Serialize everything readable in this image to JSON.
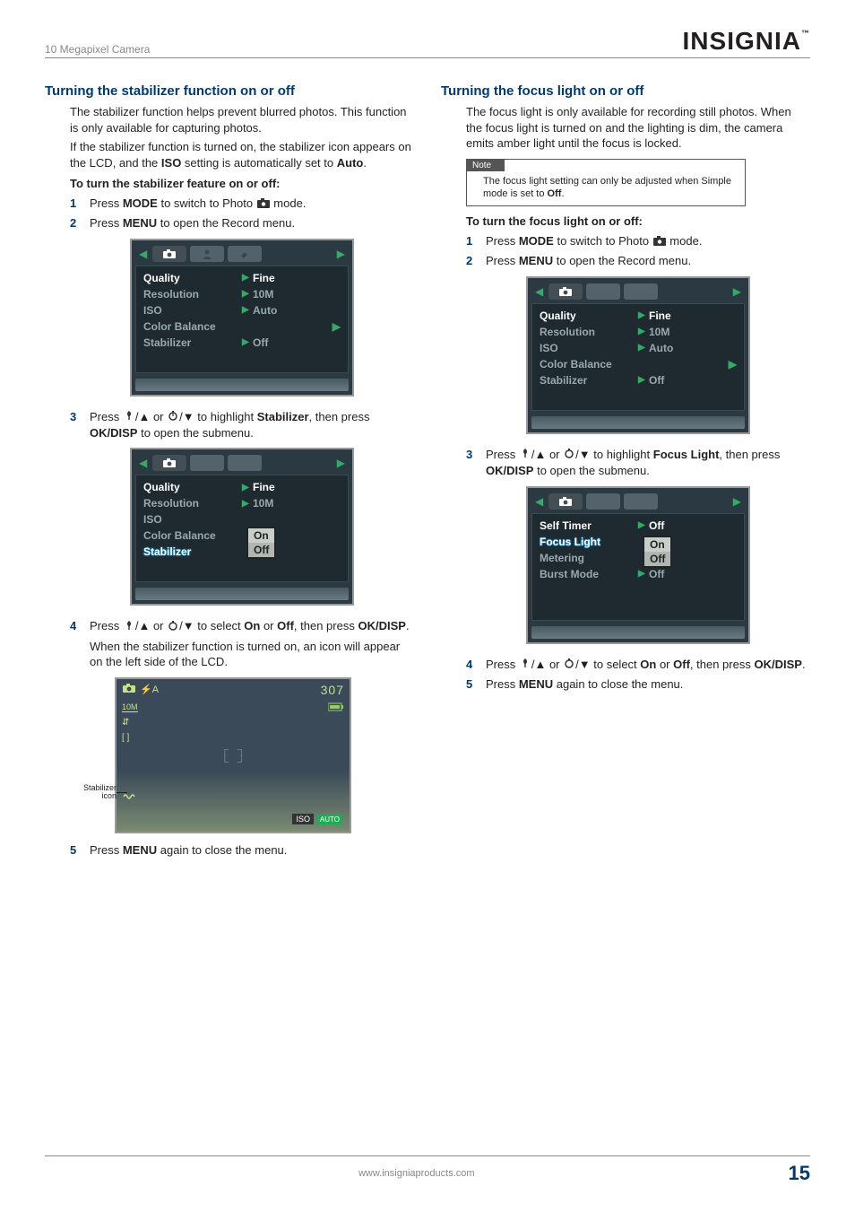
{
  "header": {
    "product": "10 Megapixel Camera",
    "brand": "INSIGNIA",
    "tm": "™"
  },
  "left": {
    "heading": "Turning the stabilizer function on or off",
    "intro1": "The stabilizer function helps prevent blurred photos. This function is only available for capturing photos.",
    "intro2_a": "If the stabilizer function is turned on, the stabilizer icon appears on the LCD, and the ",
    "intro2_iso": "ISO",
    "intro2_b": " setting is automatically set to ",
    "intro2_auto": "Auto",
    "intro2_c": ".",
    "subhead": "To turn the stabilizer feature on or off:",
    "steps": {
      "s1_a": "Press ",
      "s1_mode": "MODE",
      "s1_b": " to switch to Photo ",
      "s1_c": " mode.",
      "s2_a": "Press ",
      "s2_menu": "MENU",
      "s2_b": " to open the Record menu.",
      "s3_a": "Press ",
      "s3_b": " or ",
      "s3_c": " to highlight ",
      "s3_stab": "Stabilizer",
      "s3_d": ", then press ",
      "s3_ok": "OK/DISP",
      "s3_e": " to open the submenu.",
      "s4_a": "Press ",
      "s4_b": " or ",
      "s4_c": " to select ",
      "s4_on": "On",
      "s4_d": " or ",
      "s4_off": "Off",
      "s4_e": ", then press ",
      "s4_ok": "OK/DISP",
      "s4_f": ".",
      "s4_note": "When the stabilizer function is turned on, an icon will appear on the left side of the LCD.",
      "s5_a": "Press ",
      "s5_menu": "MENU",
      "s5_b": " again to close the menu."
    },
    "callout": "Stabilizer icon",
    "preview": {
      "counter": "307",
      "res": "10M",
      "iso": "ISO",
      "auto": "AUTO"
    }
  },
  "right": {
    "heading": "Turning the focus light on or off",
    "intro": "The focus light is only available for recording still photos. When the focus light is turned on and the lighting is dim, the camera emits amber light until the focus is locked.",
    "note_title": "Note",
    "note_a": "The focus light setting can only be adjusted when Simple mode is set to ",
    "note_off": "Off",
    "note_b": ".",
    "subhead": "To turn the focus light on or off:",
    "steps": {
      "s1_a": "Press ",
      "s1_mode": "MODE",
      "s1_b": " to switch to Photo ",
      "s1_c": " mode.",
      "s2_a": "Press ",
      "s2_menu": "MENU",
      "s2_b": " to open the Record menu.",
      "s3_a": "Press ",
      "s3_b": " or ",
      "s3_c": " to highlight ",
      "s3_fl": "Focus Light",
      "s3_d": ", then press ",
      "s3_ok": "OK/DISP",
      "s3_e": " to open the submenu.",
      "s4_a": "Press ",
      "s4_b": " or ",
      "s4_c": " to select ",
      "s4_on": "On",
      "s4_d": " or ",
      "s4_off": "Off",
      "s4_e": ", then press ",
      "s4_ok": "OK/DISP",
      "s4_f": ".",
      "s5_a": "Press ",
      "s5_menu": "MENU",
      "s5_b": " again to close the menu."
    }
  },
  "menus": {
    "record": {
      "rows": [
        {
          "label": "Quality",
          "value": "Fine",
          "sel": true,
          "caret": true
        },
        {
          "label": "Resolution",
          "value": "10M",
          "caret": true
        },
        {
          "label": "ISO",
          "value": "Auto",
          "caret": true
        },
        {
          "label": "Color Balance",
          "value": "",
          "rcaret": true
        },
        {
          "label": "Stabilizer",
          "value": "Off",
          "caret": true
        }
      ]
    },
    "record_stab": {
      "rows": [
        {
          "label": "Quality",
          "value": "Fine",
          "sel": true,
          "caret": true
        },
        {
          "label": "Resolution",
          "value": "10M",
          "caret": true
        },
        {
          "label": "ISO",
          "value": ""
        },
        {
          "label": "Color Balance",
          "value": ""
        },
        {
          "label": "Stabilizer",
          "value": "",
          "hl": true
        }
      ],
      "popup": [
        "On",
        "Off"
      ],
      "popup_sel": 1
    },
    "focuslight": {
      "rows": [
        {
          "label": "Self Timer",
          "value": "Off",
          "sel": true,
          "caret": true
        },
        {
          "label": "Focus Light",
          "value": "",
          "hl": true
        },
        {
          "label": "Metering",
          "value": ""
        },
        {
          "label": "Burst Mode",
          "value": "Off",
          "caret": true
        }
      ],
      "popup": [
        "On",
        "Off"
      ],
      "popup_sel": 1
    }
  },
  "footer": {
    "url": "www.insigniaproducts.com",
    "page": "15"
  }
}
